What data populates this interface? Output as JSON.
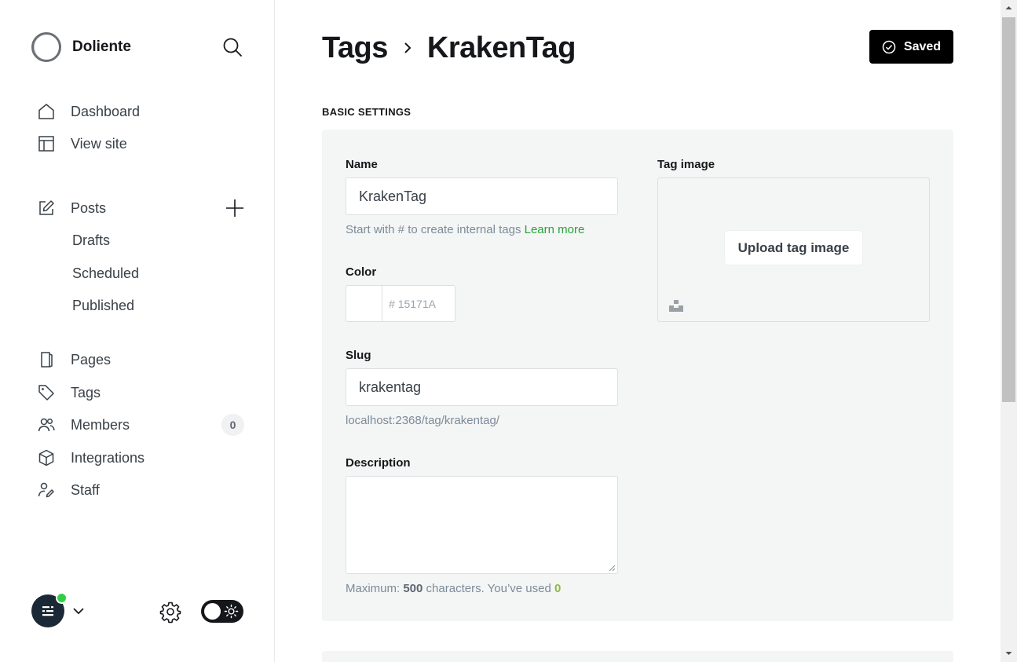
{
  "sidebar": {
    "brand_name": "Doliente",
    "nav": [
      {
        "label": "Dashboard",
        "icon": "home-icon"
      },
      {
        "label": "View site",
        "icon": "layout-icon"
      },
      {
        "label": "Posts",
        "icon": "edit-icon"
      },
      {
        "label": "Pages",
        "icon": "page-icon"
      },
      {
        "label": "Tags",
        "icon": "tag-icon"
      },
      {
        "label": "Members",
        "icon": "members-icon"
      },
      {
        "label": "Integrations",
        "icon": "cube-icon"
      },
      {
        "label": "Staff",
        "icon": "staff-icon"
      }
    ],
    "posts_sub": [
      "Drafts",
      "Scheduled",
      "Published"
    ],
    "members_count": "0"
  },
  "header": {
    "breadcrumb_parent": "Tags",
    "title": "KrakenTag",
    "save_label": "Saved"
  },
  "form": {
    "section_label": "BASIC SETTINGS",
    "name_label": "Name",
    "name_value": "KrakenTag",
    "name_hint": "Start with # to create internal tags",
    "name_hint_link": "Learn more",
    "color_label": "Color",
    "color_hash": "#",
    "color_placeholder": "15171A",
    "slug_label": "Slug",
    "slug_value": "krakentag",
    "slug_url": "localhost:2368/tag/krakentag/",
    "description_label": "Description",
    "description_value": "",
    "desc_hint_prefix": "Maximum:",
    "desc_hint_max": "500",
    "desc_hint_mid": "characters. You’ve used",
    "desc_hint_used": "0",
    "tag_image_label": "Tag image",
    "upload_label": "Upload tag image"
  },
  "colors": {
    "accent_green": "#30cf43",
    "text_dark": "#15171a",
    "panel_bg": "#f4f5f5"
  }
}
